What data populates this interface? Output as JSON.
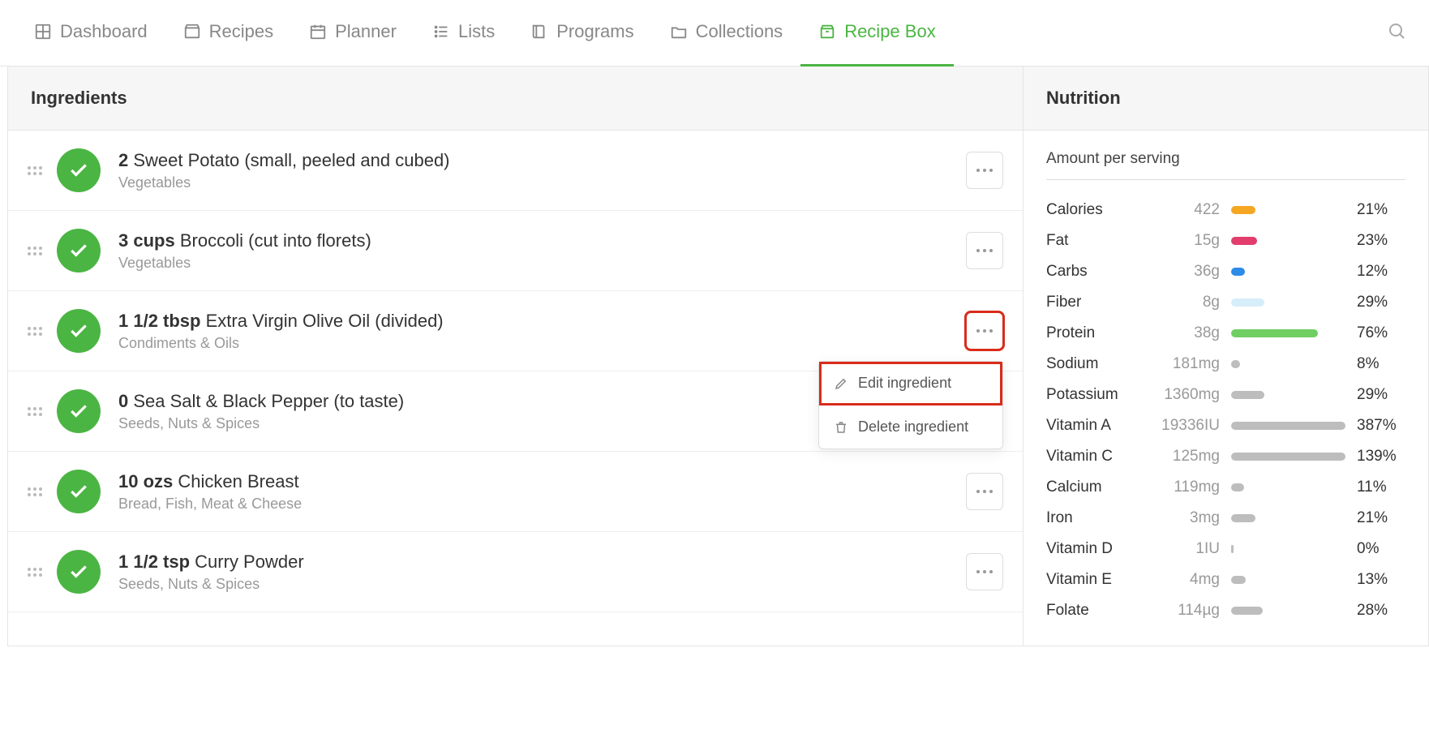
{
  "nav": {
    "items": [
      {
        "label": "Dashboard"
      },
      {
        "label": "Recipes"
      },
      {
        "label": "Planner"
      },
      {
        "label": "Lists"
      },
      {
        "label": "Programs"
      },
      {
        "label": "Collections"
      },
      {
        "label": "Recipe Box"
      }
    ],
    "activeIndex": 6
  },
  "ingredients": {
    "header": "Ingredients",
    "rows": [
      {
        "qty": "2",
        "name": "Sweet Potato (small, peeled and cubed)",
        "category": "Vegetables"
      },
      {
        "qty": "3 cups",
        "name": "Broccoli (cut into florets)",
        "category": "Vegetables"
      },
      {
        "qty": "1 1/2 tbsp",
        "name": "Extra Virgin Olive Oil (divided)",
        "category": "Condiments & Oils",
        "menuOpen": true
      },
      {
        "qty": "0",
        "name": "Sea Salt & Black Pepper (to taste)",
        "category": "Seeds, Nuts & Spices"
      },
      {
        "qty": "10 ozs",
        "name": "Chicken Breast",
        "category": "Bread, Fish, Meat & Cheese"
      },
      {
        "qty": "1 1/2 tsp",
        "name": "Curry Powder",
        "category": "Seeds, Nuts & Spices"
      }
    ],
    "menu": {
      "edit": "Edit ingredient",
      "delete": "Delete ingredient"
    }
  },
  "nutrition": {
    "header": "Nutrition",
    "subhead": "Amount per serving",
    "rows": [
      {
        "label": "Calories",
        "value": "422",
        "pct": "21%",
        "barPct": 21,
        "color": "#f5a623"
      },
      {
        "label": "Fat",
        "value": "15g",
        "pct": "23%",
        "barPct": 23,
        "color": "#e23d6d"
      },
      {
        "label": "Carbs",
        "value": "36g",
        "pct": "12%",
        "barPct": 12,
        "color": "#2d8ce8"
      },
      {
        "label": "Fiber",
        "value": "8g",
        "pct": "29%",
        "barPct": 29,
        "color": "#d6eef9"
      },
      {
        "label": "Protein",
        "value": "38g",
        "pct": "76%",
        "barPct": 76,
        "color": "#6fcf63"
      },
      {
        "label": "Sodium",
        "value": "181mg",
        "pct": "8%",
        "barPct": 8,
        "color": "#bdbdbd"
      },
      {
        "label": "Potassium",
        "value": "1360mg",
        "pct": "29%",
        "barPct": 29,
        "color": "#bdbdbd"
      },
      {
        "label": "Vitamin A",
        "value": "19336IU",
        "pct": "387%",
        "barPct": 100,
        "color": "#bdbdbd"
      },
      {
        "label": "Vitamin C",
        "value": "125mg",
        "pct": "139%",
        "barPct": 100,
        "color": "#bdbdbd"
      },
      {
        "label": "Calcium",
        "value": "119mg",
        "pct": "11%",
        "barPct": 11,
        "color": "#bdbdbd"
      },
      {
        "label": "Iron",
        "value": "3mg",
        "pct": "21%",
        "barPct": 21,
        "color": "#bdbdbd"
      },
      {
        "label": "Vitamin D",
        "value": "1IU",
        "pct": "0%",
        "barPct": 2,
        "color": "#bdbdbd"
      },
      {
        "label": "Vitamin E",
        "value": "4mg",
        "pct": "13%",
        "barPct": 13,
        "color": "#bdbdbd"
      },
      {
        "label": "Folate",
        "value": "114µg",
        "pct": "28%",
        "barPct": 28,
        "color": "#bdbdbd"
      }
    ]
  }
}
